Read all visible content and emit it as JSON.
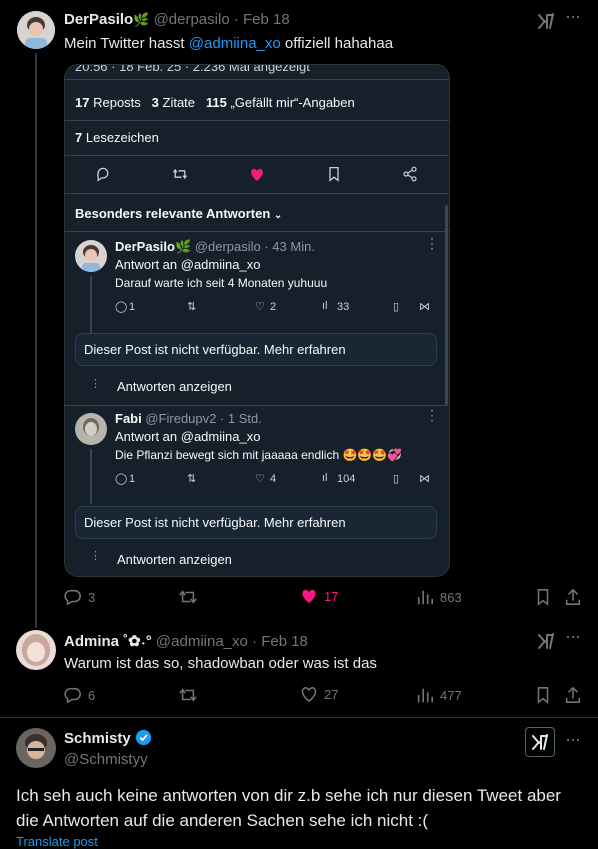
{
  "post1": {
    "display_name": "DerPasilo",
    "emoji": "🌿",
    "handle": "@derpasilo",
    "date": "· Feb 18",
    "text_before": "Mein Twitter hasst ",
    "mention": "@admiina_xo",
    "text_after": " offiziell hahahaa",
    "stats": {
      "replies": "3",
      "reposts": "",
      "likes": "17",
      "views": "863"
    },
    "like_color": "#f91880"
  },
  "card": {
    "top_meta": "20:56 · 18 Feb. 25 · 2.236 Mal angezeigt",
    "reposts_num": "17",
    "reposts_label": "Reposts",
    "quotes_num": "3",
    "quotes_label": "Zitate",
    "likes_num": "115",
    "likes_label": "„Gefällt mir“-Angaben",
    "bookmarks_num": "7",
    "bookmarks_label": "Lesezeichen",
    "relevant_label": "Besonders relevante Antworten",
    "reply1": {
      "name": "DerPasilo",
      "emoji": "🌿",
      "handle_time": "@derpasilo · 43 Min.",
      "reply_to": "Antwort an @admiina_xo",
      "text": "Darauf warte ich seit 4 Monaten yuhuuu",
      "replies": "1",
      "likes": "2",
      "views": "33"
    },
    "unavailable1": "Dieser Post ist nicht verfügbar. Mehr erfahren",
    "show_replies1": "Antworten anzeigen",
    "reply2": {
      "name": "Fabi",
      "handle_time": "@Firedupv2 · 1 Std.",
      "reply_to": "Antwort an @admiina_xo",
      "text": "Die Pflanzi bewegt sich mit jaaaaa endlich 🤩🤩🤩💞",
      "replies": "1",
      "likes": "4",
      "views": "104"
    },
    "unavailable2": "Dieser Post ist nicht verfügbar. Mehr erfahren",
    "show_replies2": "Antworten anzeigen"
  },
  "post2": {
    "display_name": "Admina ˚✿˖°",
    "handle": "@admiina_xo",
    "date": "· Feb 18",
    "text": "Warum ist das so, shadowban oder was ist das",
    "stats": {
      "replies": "6",
      "likes": "27",
      "views": "477"
    }
  },
  "post3": {
    "display_name": "Schmisty",
    "handle": "@Schmistyy",
    "text": "Ich seh auch keine antworten von dir z.b sehe ich nur diesen Tweet aber die Antworten auf die anderen Sachen sehe ich nicht :(",
    "translate": "Translate post",
    "verified_color": "#1d9bf0"
  },
  "icons": [
    "grok-icon",
    "more-icon",
    "reply-icon",
    "repost-icon",
    "like-icon",
    "views-icon",
    "bookmark-icon",
    "share-icon",
    "verified-badge-icon",
    "chevron-down-icon"
  ]
}
